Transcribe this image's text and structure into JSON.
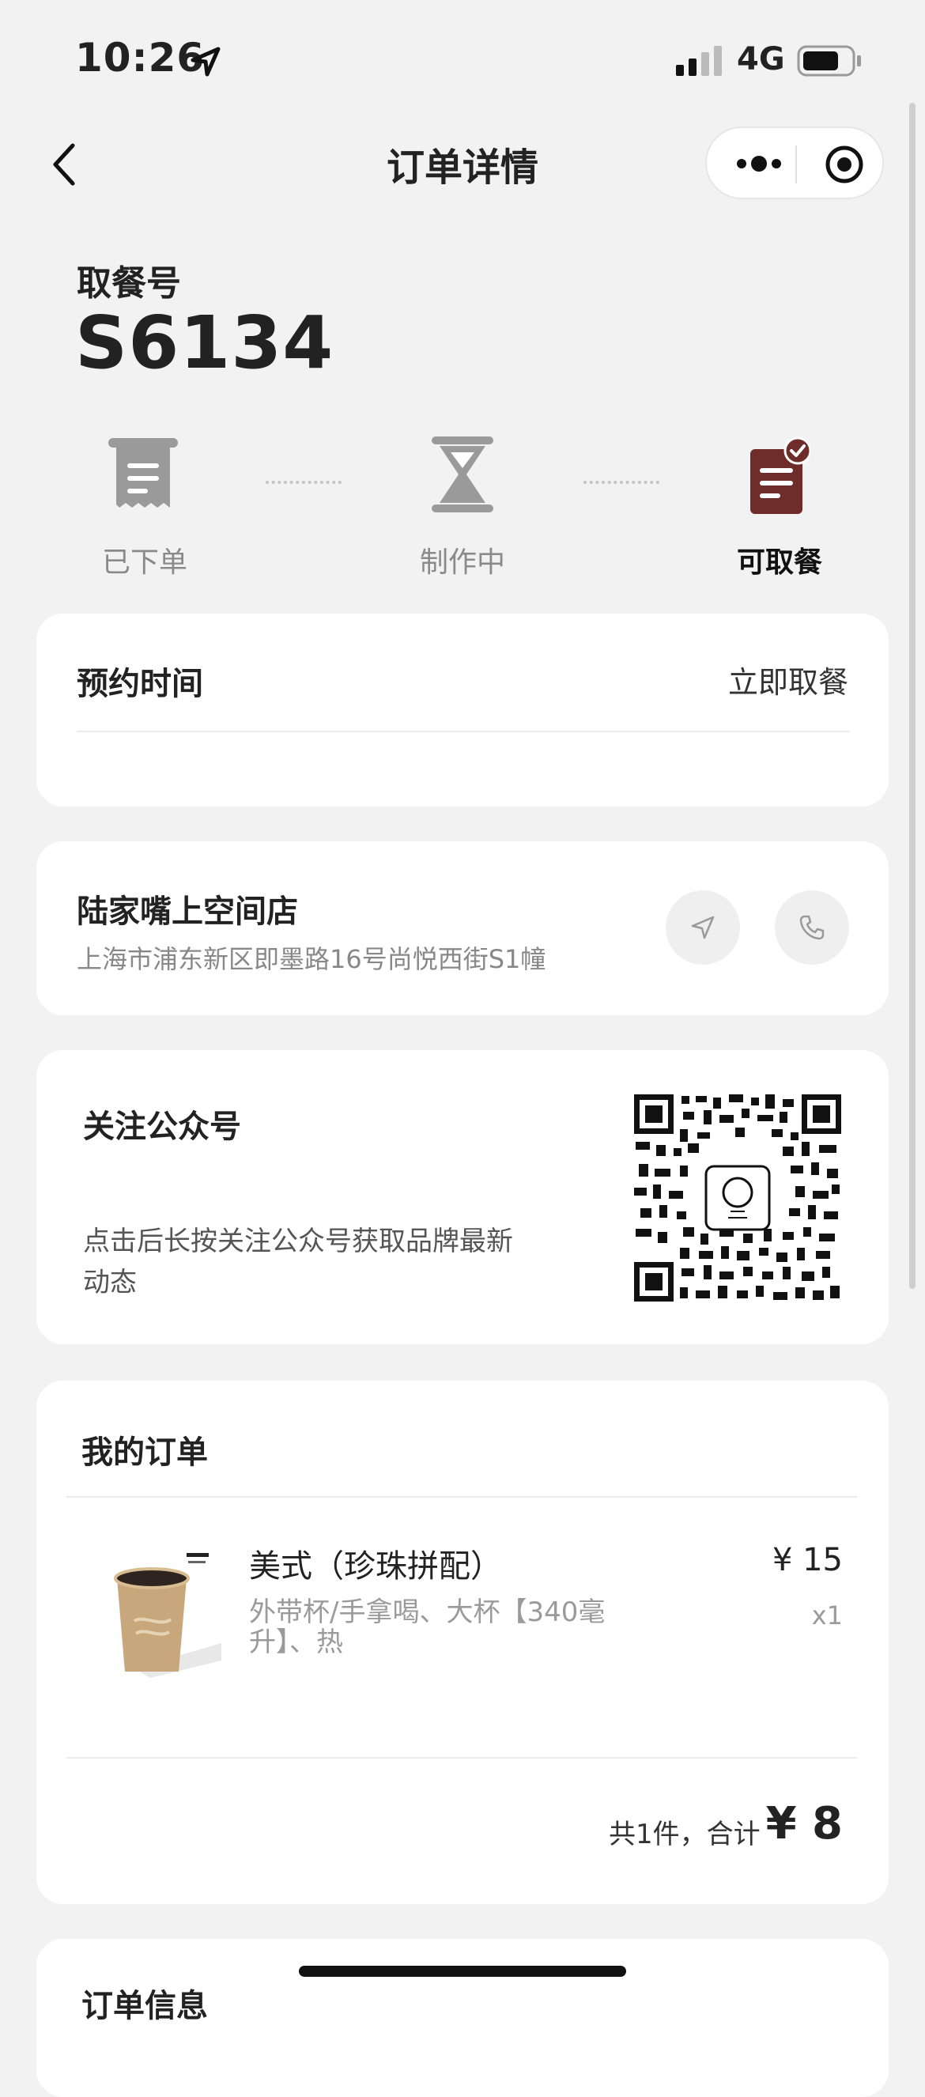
{
  "status_bar": {
    "time": "10:26",
    "network": "4G"
  },
  "nav": {
    "title": "订单详情"
  },
  "pickup": {
    "label": "取餐号",
    "number": "S6134"
  },
  "steps": [
    {
      "label": "已下单"
    },
    {
      "label": "制作中"
    },
    {
      "label": "可取餐"
    }
  ],
  "reservation": {
    "label": "预约时间",
    "value": "立即取餐"
  },
  "store": {
    "name": "陆家嘴上空间店",
    "address": "上海市浦东新区即墨路16号尚悦西街S1幢"
  },
  "follow": {
    "title": "关注公众号",
    "desc": "点击后长按关注公众号获取品牌最新动态"
  },
  "order": {
    "title": "我的订单",
    "item": {
      "name": "美式（珍珠拼配）",
      "spec": "外带杯/手拿喝、大杯【340毫升】、热",
      "price": "¥ 15",
      "qty": "x1"
    },
    "total_label": "共1件，合计",
    "total_value": "¥ 8"
  },
  "order_info": {
    "title": "订单信息"
  },
  "colors": {
    "accent": "#6e2c2a",
    "background": "#f2f2f2"
  }
}
